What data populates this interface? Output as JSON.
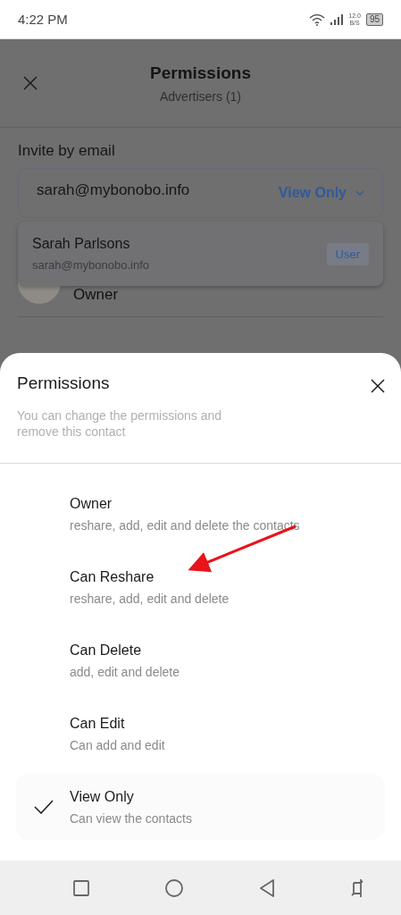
{
  "status_bar": {
    "time": "4:22 PM",
    "net_speed_value": "12.0",
    "net_speed_unit": "B/S",
    "battery": "95"
  },
  "header": {
    "title": "Permissions",
    "subtitle": "Advertisers (1)"
  },
  "invite": {
    "label": "Invite by email",
    "value": "sarah@mybonobo.info",
    "role": "View Only"
  },
  "suggestion": {
    "name": "Sarah Parlsons",
    "email": "sarah@mybonobo.info",
    "badge": "User"
  },
  "member": {
    "role": "Owner"
  },
  "sheet": {
    "title": "Permissions",
    "description": "You can change the permissions and remove this contact",
    "options": [
      {
        "title": "Owner",
        "description": "reshare, add, edit and delete the contacts",
        "selected": false
      },
      {
        "title": "Can Reshare",
        "description": "reshare, add, edit and delete",
        "selected": false
      },
      {
        "title": "Can Delete",
        "description": "add, edit and delete",
        "selected": false
      },
      {
        "title": "Can Edit",
        "description": "Can add and edit",
        "selected": false
      },
      {
        "title": "View Only",
        "description": "Can view the contacts",
        "selected": true
      }
    ]
  }
}
